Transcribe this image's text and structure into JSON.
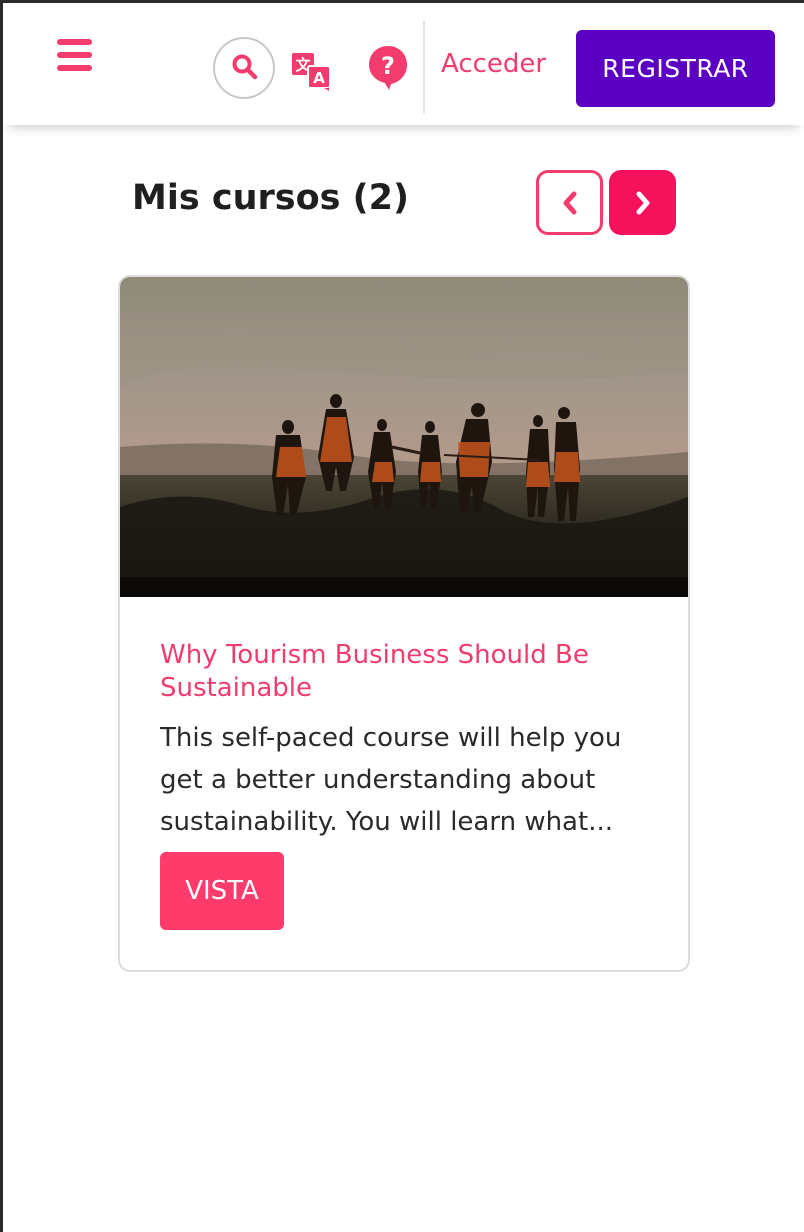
{
  "header": {
    "menu_icon": "hamburger-menu-icon",
    "search_icon": "search-icon",
    "translate_icon": "translate-icon",
    "help_icon": "help-icon",
    "login_label": "Acceder",
    "register_label": "REGISTRAR"
  },
  "courses": {
    "title": "Mis cursos (2)",
    "prev_icon": "chevron-left-icon",
    "next_icon": "chevron-right-icon",
    "items": [
      {
        "title": "Why Tourism Business Should Be Sustainable",
        "description": "This self-paced course will help you get a better understanding about sustainability. You will learn what...",
        "button_label": "VISTA"
      }
    ]
  },
  "colors": {
    "accent": "#f23c6e",
    "register_button": "#5b00c2",
    "next_button": "#f5115b",
    "view_button": "#ff3b6b"
  }
}
